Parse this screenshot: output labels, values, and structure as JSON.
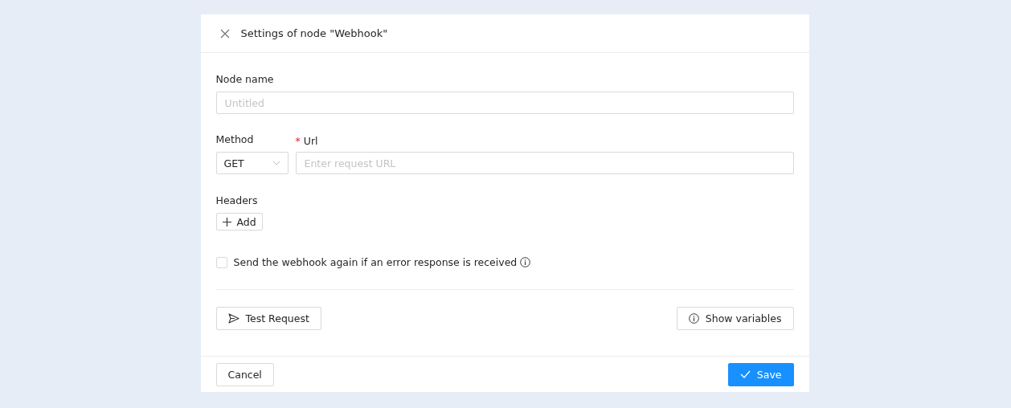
{
  "dialog": {
    "title": "Settings of node \"Webhook\""
  },
  "node_name": {
    "label": "Node name",
    "placeholder": "Untitled"
  },
  "method": {
    "label": "Method",
    "value": "GET"
  },
  "url": {
    "label": "Url",
    "required_mark": "*",
    "placeholder": "Enter request URL"
  },
  "headers": {
    "label": "Headers",
    "add_button": "Add"
  },
  "retry": {
    "label": "Send the webhook again if an error response is received",
    "checked": false
  },
  "actions": {
    "test_button": "Test Request",
    "variables_button": "Show variables"
  },
  "footer": {
    "cancel_button": "Cancel",
    "save_button": "Save"
  }
}
